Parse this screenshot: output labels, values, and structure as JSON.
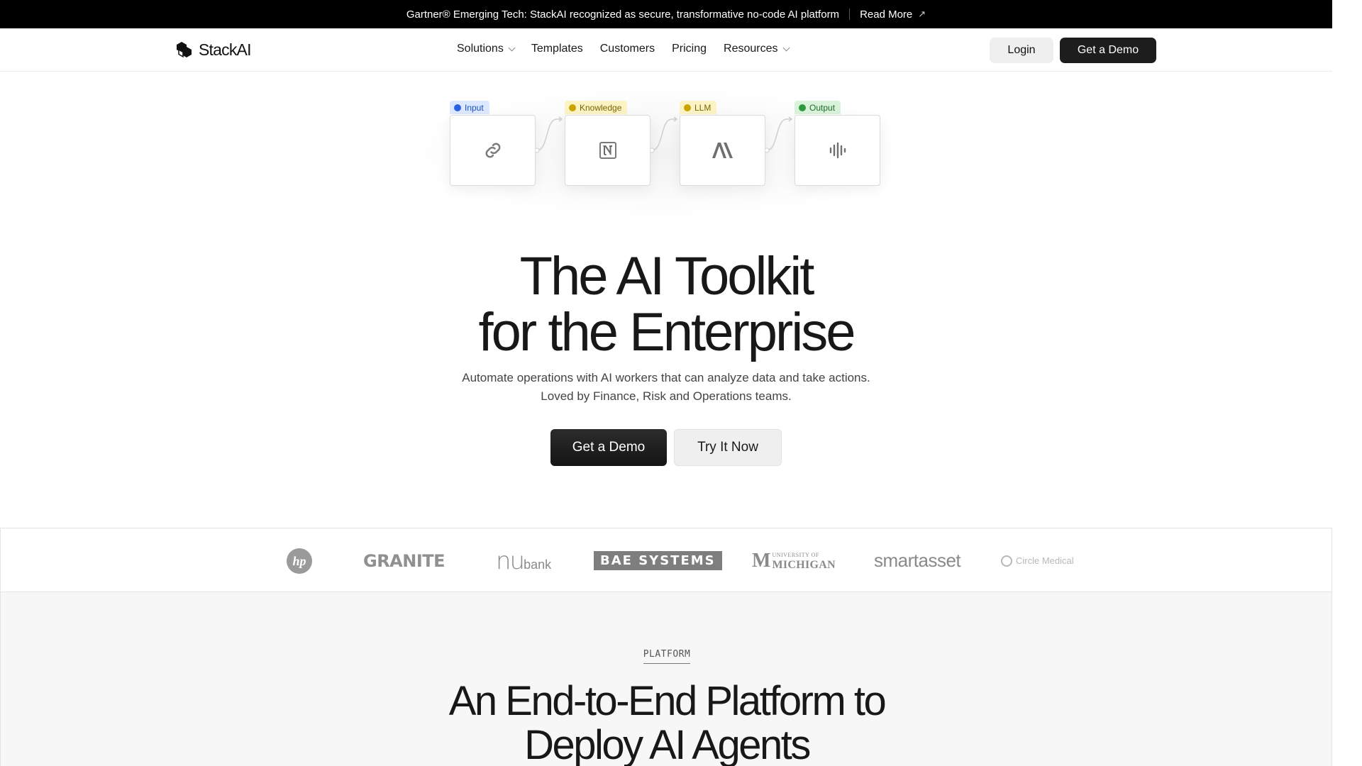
{
  "announcement": {
    "text": "Gartner® Emerging Tech: StackAI recognized as secure, transformative no-code AI platform",
    "link_label": "Read More",
    "link_icon": "arrow-up-right-icon"
  },
  "nav": {
    "brand": "StackAI",
    "links": [
      {
        "label": "Solutions",
        "has_dropdown": true
      },
      {
        "label": "Templates",
        "has_dropdown": false
      },
      {
        "label": "Customers",
        "has_dropdown": false
      },
      {
        "label": "Pricing",
        "has_dropdown": false
      },
      {
        "label": "Resources",
        "has_dropdown": true
      }
    ],
    "login_label": "Login",
    "demo_label": "Get a Demo"
  },
  "workflow": {
    "nodes": [
      {
        "tag": "Input",
        "icon": "link-icon"
      },
      {
        "tag": "Knowledge",
        "icon": "notion-icon"
      },
      {
        "tag": "LLM",
        "icon": "anthropic-icon"
      },
      {
        "tag": "Output",
        "icon": "audio-wave-icon"
      }
    ]
  },
  "hero": {
    "title_line1": "The AI Toolkit",
    "title_line2": "for the Enterprise",
    "subtitle_line1": "Automate operations with AI workers that can analyze data and take actions.",
    "subtitle_line2": "Loved by Finance, Risk and Operations teams.",
    "primary_cta": "Get a Demo",
    "secondary_cta": "Try It Now"
  },
  "logos": [
    {
      "name": "hp"
    },
    {
      "name": "GRANITE"
    },
    {
      "name": "nu",
      "suffix": "bank"
    },
    {
      "name": "BAE SYSTEMS"
    },
    {
      "name": "MICHIGAN",
      "prefix": "UNIVERSITY OF"
    },
    {
      "name": "smartasset"
    },
    {
      "name": "Circle Medical"
    }
  ],
  "platform": {
    "eyebrow": "PLATFORM",
    "title_line1": "An End-to-End Platform to",
    "title_line2": "Deploy AI Agents"
  },
  "colors": {
    "announcement_bg": "#000000",
    "primary_button": "#1d1d1d",
    "secondary_button": "#efefef",
    "input_tag": "#dbe8ff",
    "knowledge_tag": "#fbf3c4",
    "llm_tag": "#fbf3c4",
    "output_tag": "#d8f3da"
  }
}
